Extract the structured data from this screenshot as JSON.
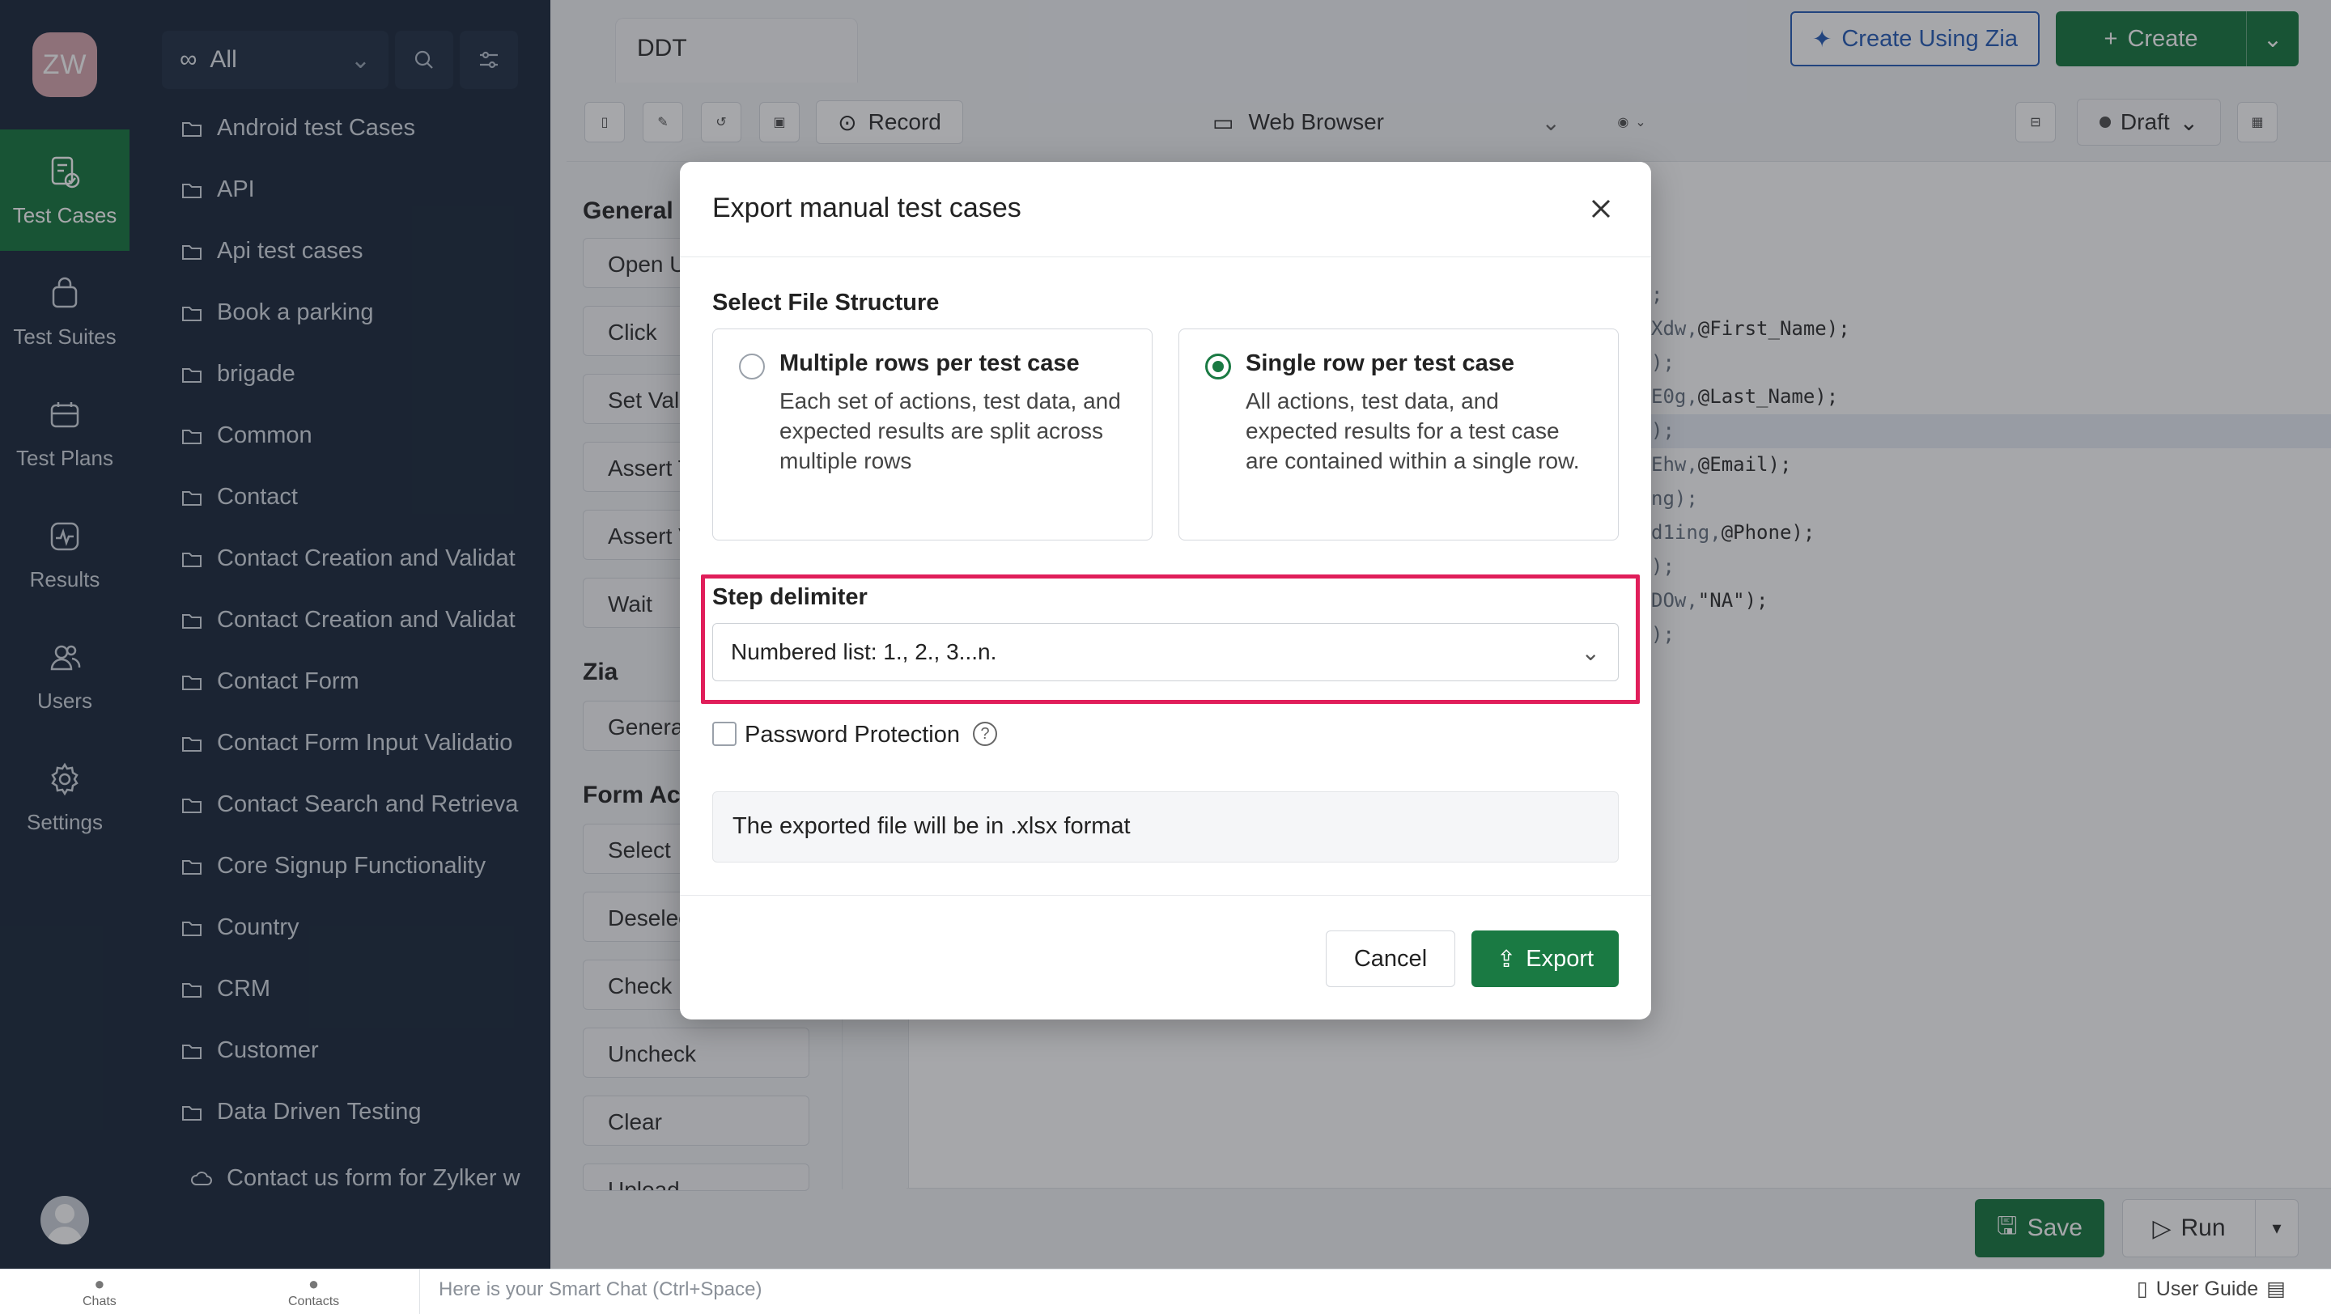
{
  "user_initials": "ZW",
  "rail": [
    {
      "label": "Test Cases",
      "icon": "test-cases-icon",
      "active": true
    },
    {
      "label": "Test Suites",
      "icon": "test-suites-icon"
    },
    {
      "label": "Test Plans",
      "icon": "test-plans-icon"
    },
    {
      "label": "Results",
      "icon": "results-icon"
    },
    {
      "label": "Users",
      "icon": "users-icon"
    },
    {
      "label": "Settings",
      "icon": "settings-icon"
    }
  ],
  "folder_filter": {
    "label": "All"
  },
  "folders": [
    "Android test Cases",
    "API",
    "Api test cases",
    "Book a parking",
    "brigade",
    "Common",
    "Contact",
    "Contact Creation and Validat",
    "Contact Creation and Validat",
    "Contact Form",
    "Contact Form Input Validatio",
    "Contact Search and Retrieval",
    "Core Signup Functionality",
    "Country",
    "CRM",
    "Customer",
    "Data Driven Testing"
  ],
  "sub_item": "Contact us form for Zylker w",
  "editor": {
    "tab": "DDT",
    "create_zia": "Create Using Zia",
    "create": "Create",
    "record": "Record",
    "platform": "Web Browser",
    "status": "Draft"
  },
  "palette": {
    "general_title": "General",
    "general_actions": [
      "Open U",
      "Click",
      "Set Valu",
      "Assert T",
      "Assert V",
      "Wait"
    ],
    "zia_title": "Zia",
    "zia_actions": [
      "Genera"
    ],
    "form_title": "Form Act",
    "form_actions": [
      "Select",
      "Deselec",
      "Check",
      "Uncheck",
      "Clear",
      "Upload"
    ]
  },
  "code_lines": [
    {
      "a": ";",
      "b": ""
    },
    {
      "a": "Xdw,",
      "b": "@First_Name);"
    },
    {
      "a": ");",
      "b": ""
    },
    {
      "a": "E0g,",
      "b": "@Last_Name);"
    },
    {
      "a": ");",
      "b": ""
    },
    {
      "a": "Ehw,",
      "b": "@Email);"
    },
    {
      "a": "ng);",
      "b": ""
    },
    {
      "a": "d1ing,",
      "b": "@Phone);"
    },
    {
      "a": ");",
      "b": ""
    },
    {
      "a": "DOw,",
      "b": "\"NA\");"
    },
    {
      "a": ");",
      "b": ""
    }
  ],
  "footer": {
    "save": "Save",
    "run": "Run"
  },
  "status_bar": {
    "chats": "Chats",
    "contacts": "Contacts",
    "smart_chat_placeholder": "Here is your Smart Chat (Ctrl+Space)",
    "user_guide": "User Guide"
  },
  "modal": {
    "title": "Export manual test cases",
    "file_structure_label": "Select File Structure",
    "options": [
      {
        "title": "Multiple rows per test case",
        "desc": "Each set of actions, test data, and expected results are split across multiple rows",
        "selected": false
      },
      {
        "title": "Single row per test case",
        "desc": "All actions, test data, and expected results for a test case are contained within a single row.",
        "selected": true
      }
    ],
    "step_delimiter_label": "Step delimiter",
    "step_delimiter_value": "Numbered list: 1., 2., 3...n.",
    "password_label": "Password Protection",
    "password_checked": false,
    "info": "The exported file will be in .xlsx format",
    "cancel": "Cancel",
    "export": "Export"
  },
  "colors": {
    "brand_green": "#1a7a43",
    "sidebar_bg": "#1f2d3f",
    "highlight": "#e01e5a",
    "zia_blue": "#2a5fb8"
  }
}
